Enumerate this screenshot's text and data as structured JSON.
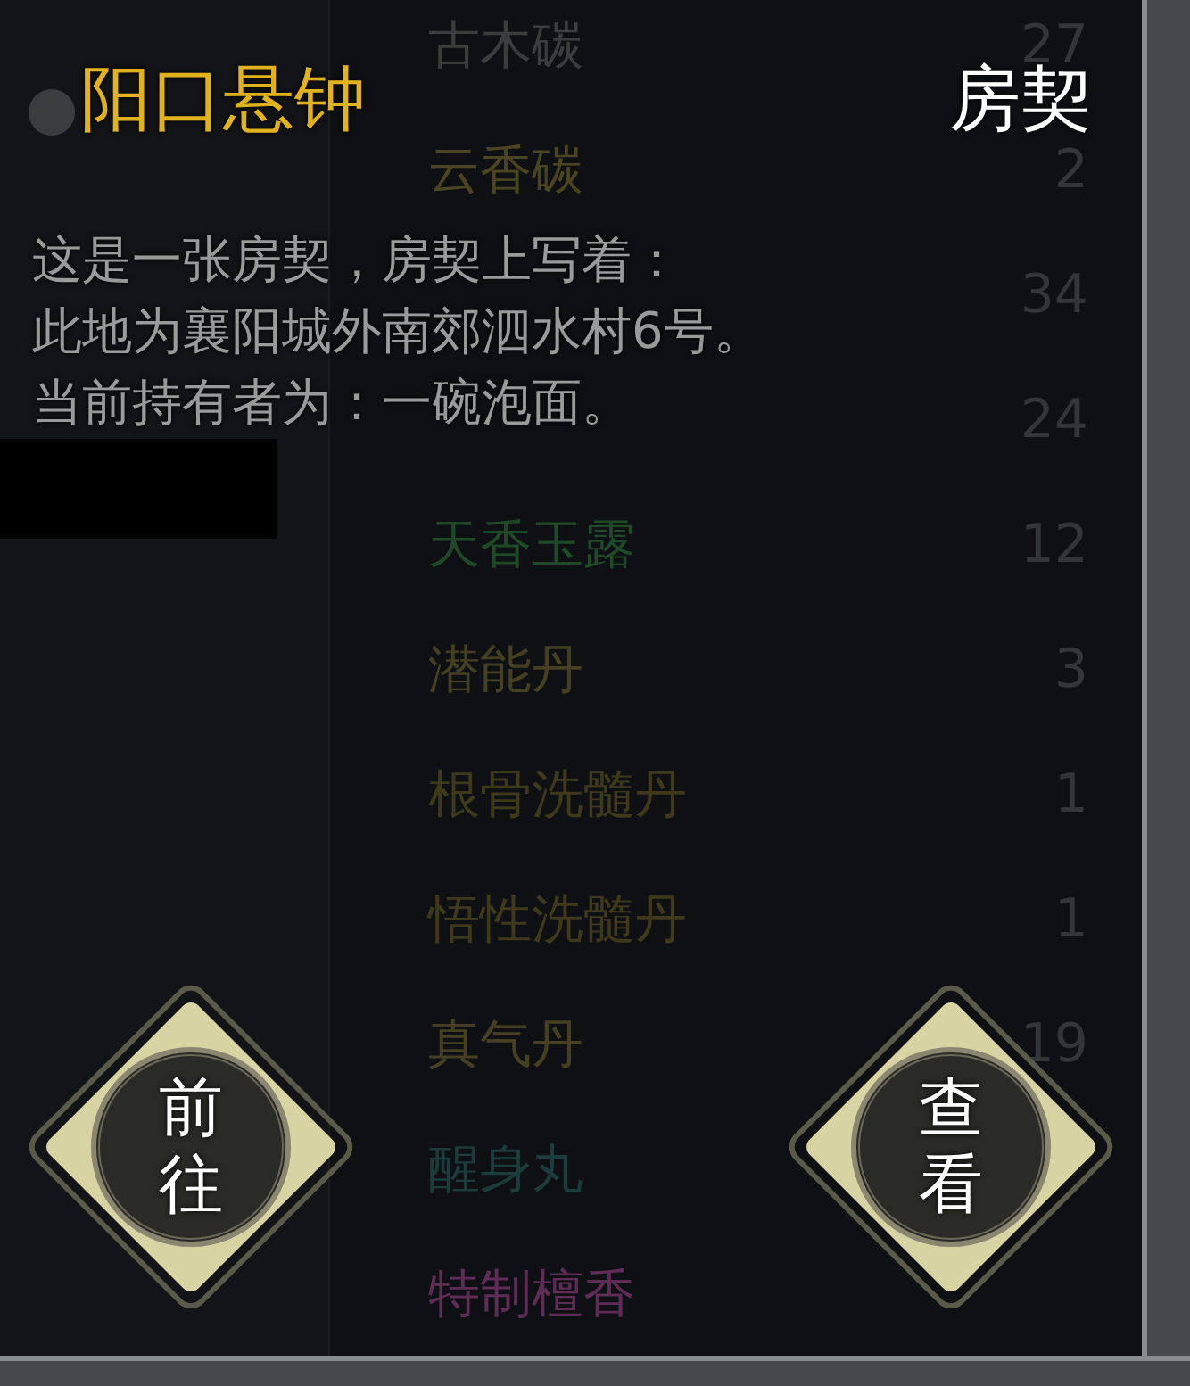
{
  "inventory": [
    {
      "name": "古木碳",
      "count": "27",
      "color": "#3c3c3c"
    },
    {
      "name": "云香碳",
      "count": "2",
      "color": "#4a4520"
    },
    {
      "count": "34"
    },
    {
      "count": "24"
    },
    {
      "name": "天香玉露",
      "count": "12",
      "color": "#1f4a27"
    },
    {
      "name": "潜能丹",
      "count": "3",
      "color": "#454022"
    },
    {
      "name": "根骨洗髓丹",
      "count": "1",
      "color": "#3f391c"
    },
    {
      "name": "悟性洗髓丹",
      "count": "1",
      "color": "#3f391c"
    },
    {
      "name": "真气丹",
      "count": "19",
      "color": "#454022"
    },
    {
      "name": "醒身丸",
      "color": "#1c3b3b"
    },
    {
      "name": "特制檀香",
      "color": "#5e2c56"
    }
  ],
  "popup": {
    "location": "阳口悬钟",
    "item_name": "房契",
    "description": [
      "这是一张房契，房契上写着：",
      "此地为襄阳城外南郊泗水村6号。",
      "当前持有者为：一碗泡面。"
    ],
    "buttons": [
      {
        "label": "前往"
      },
      {
        "label": "查看"
      }
    ]
  }
}
